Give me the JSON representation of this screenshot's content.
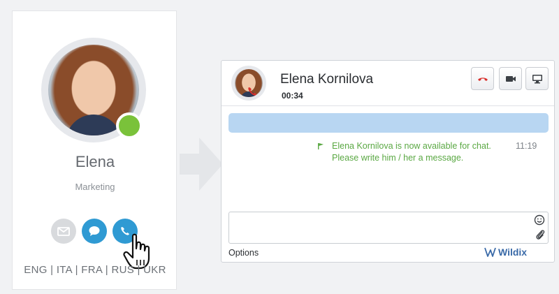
{
  "contact": {
    "name": "Elena",
    "department": "Marketing",
    "presence": "available",
    "actions": [
      "email",
      "chat",
      "call"
    ],
    "languages": "ENG | ITA | FRA | RUS | UKR"
  },
  "chat": {
    "contact_name": "Elena Kornilova",
    "call_timer": "00:34",
    "buttons": [
      "hangup",
      "video",
      "screen-share"
    ],
    "message": {
      "text": "Elena Kornilova is now available for chat. Please write him / her a message.",
      "time": "11:19"
    },
    "input_placeholder": "",
    "options_label": "Options",
    "brand": "Wildix"
  },
  "colors": {
    "accent": "#2f9ad3",
    "presence_green": "#7ac23a",
    "system_message": "#5aa843",
    "hangup": "#d9302c",
    "banner": "#b8d6f2"
  },
  "icons": {
    "email": "envelope-icon",
    "chat": "speech-bubble-icon",
    "call": "phone-icon",
    "hangup": "phone-hangup-icon",
    "video": "video-camera-icon",
    "screen": "monitor-icon",
    "emoji": "smiley-icon",
    "attach": "paperclip-icon",
    "flag": "flag-icon",
    "cursor": "hand-pointer-icon"
  }
}
